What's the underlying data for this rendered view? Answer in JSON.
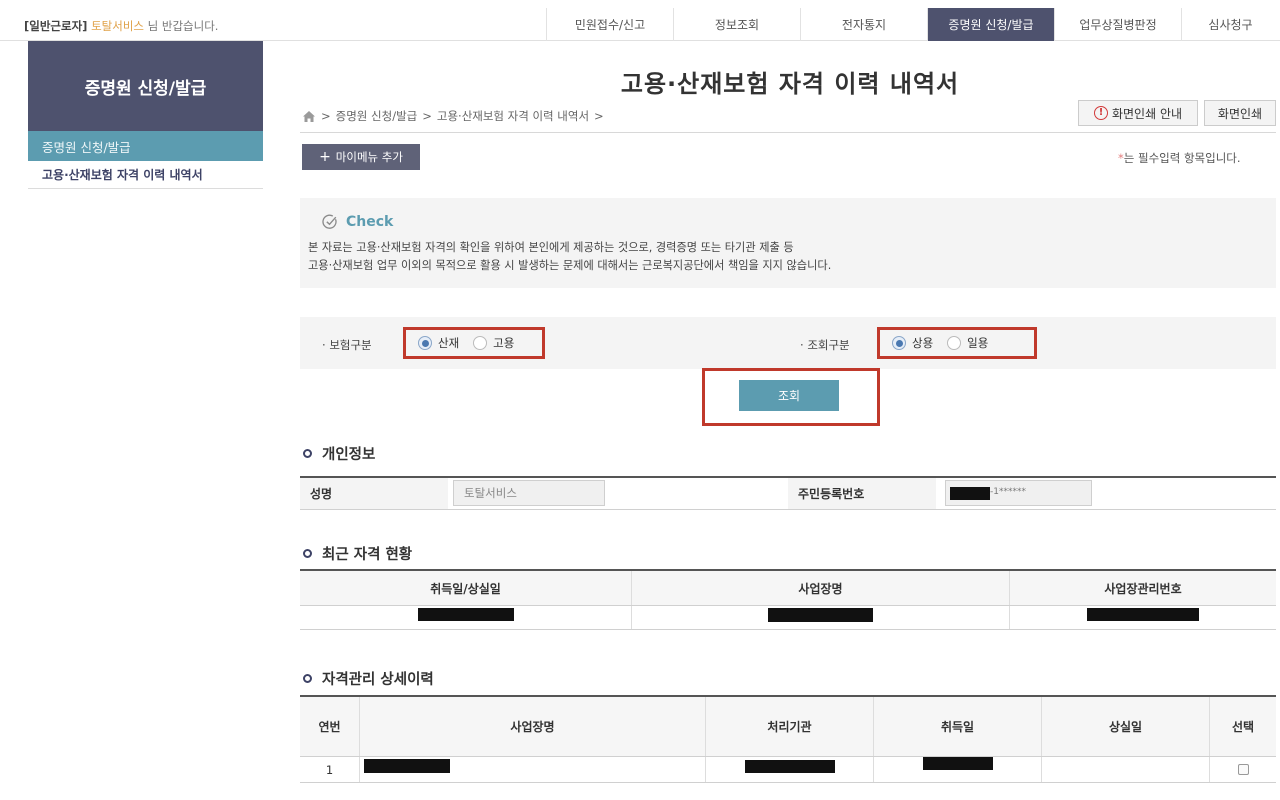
{
  "topbar": {
    "role": "[일반근로자]",
    "user_name": "토탈서비스",
    "greeting_suffix": "님 반갑습니다.",
    "menu": [
      "민원접수/신고",
      "정보조회",
      "전자통지",
      "증명원 신청/발급",
      "업무상질병판정",
      "심사청구"
    ],
    "active_index": 3
  },
  "sidebar": {
    "title": "증명원 신청/발급",
    "section": "증명원 신청/발급",
    "item": "고용·산재보험 자격 이력 내역서"
  },
  "page": {
    "title": "고용·산재보험 자격 이력 내역서",
    "breadcrumb": [
      "증명원 신청/발급",
      "고용·산재보험 자격 이력 내역서"
    ],
    "print_guide_label": "화면인쇄 안내",
    "print_label": "화면인쇄",
    "mymenu_label": "마이메뉴 추가",
    "required_star": "*",
    "required_note": "는 필수입력 항목입니다."
  },
  "check": {
    "title": "Check",
    "line1": "본 자료는 고용·산재보험 자격의 확인을 위하여 본인에게 제공하는 것으로, 경력증명 또는 타기관 제출 등",
    "line2": "고용·산재보험 업무 이외의 목적으로 활용 시 발생하는 문제에 대해서는 근로복지공단에서 책임을 지지 않습니다."
  },
  "search": {
    "insurance_label": "보험구분",
    "insurance_options": [
      "산재",
      "고용"
    ],
    "insurance_selected": "산재",
    "query_label": "조회구분",
    "query_options": [
      "상용",
      "일용"
    ],
    "query_selected": "상용",
    "button_label": "조회"
  },
  "personal": {
    "section_title": "개인정보",
    "name_label": "성명",
    "name_value": "토탈서비스",
    "rrn_label": "주민등록번호",
    "rrn_suffix": "-1******"
  },
  "recent": {
    "section_title": "최근 자격 현황",
    "headers": [
      "취득일/상실일",
      "사업장명",
      "사업장관리번호"
    ]
  },
  "detail": {
    "section_title": "자격관리 상세이력",
    "headers": [
      "연번",
      "사업장명",
      "처리기관",
      "취득일",
      "상실일",
      "선택"
    ],
    "rows": [
      {
        "no": "1"
      }
    ]
  },
  "colors": {
    "nav_active": "#4e526e",
    "accent_teal": "#5c9cb0",
    "highlight_red": "#c0392b"
  }
}
